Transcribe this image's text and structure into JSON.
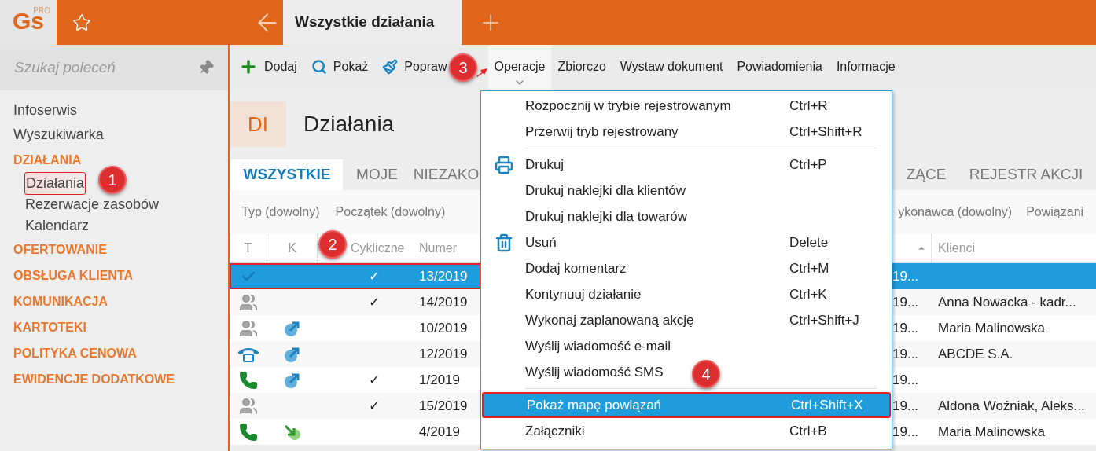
{
  "logo": {
    "text": "Gs",
    "badge": "PRO"
  },
  "top_tabs": [
    {
      "label": "Wszystkie działania",
      "selected": true
    }
  ],
  "sidebar": {
    "search": {
      "placeholder": "Szukaj poleceń"
    },
    "items": [
      {
        "kind": "link",
        "label": "Infoserwis"
      },
      {
        "kind": "link",
        "label": "Wyszukiwarka"
      },
      {
        "kind": "section",
        "label": "DZIAŁANIA",
        "children": [
          {
            "label": "Działania",
            "selected": true,
            "outlined": true
          },
          {
            "label": "Rezerwacje zasobów",
            "selected": false,
            "outlined": false
          },
          {
            "label": "Kalendarz",
            "selected": false,
            "outlined": false
          }
        ]
      },
      {
        "kind": "section",
        "label": "OFERTOWANIE"
      },
      {
        "kind": "section",
        "label": "OBSŁUGA KLIENTA"
      },
      {
        "kind": "section",
        "label": "KOMUNIKACJA"
      },
      {
        "kind": "section",
        "label": "KARTOTEKI"
      },
      {
        "kind": "section",
        "label": "POLITYKA CENOWA"
      },
      {
        "kind": "section",
        "label": "EWIDENCJE DODATKOWE"
      }
    ]
  },
  "toolbar": [
    {
      "kind": "add",
      "label": "Dodaj",
      "open": false
    },
    {
      "kind": "show",
      "label": "Pokaż",
      "open": false
    },
    {
      "kind": "edit",
      "label": "Popraw",
      "open": false
    },
    {
      "kind": "plain",
      "label": "Operacje",
      "open": true
    },
    {
      "kind": "plain",
      "label": "Zbiorczo",
      "open": false
    },
    {
      "kind": "plain",
      "label": "Wystaw dokument",
      "open": false
    },
    {
      "kind": "plain",
      "label": "Powiadomienia",
      "open": false
    },
    {
      "kind": "plain",
      "label": "Informacje",
      "open": false
    }
  ],
  "header": {
    "badge": "DI",
    "title": "Działania"
  },
  "view_tabs": [
    {
      "label": "WSZYSTKIE",
      "selected": true
    },
    {
      "label": "MOJE",
      "selected": false
    },
    {
      "label": "NIEZAKO",
      "selected": false
    },
    {
      "label": "ZĄCE",
      "selected": false
    },
    {
      "label": "REJESTR AKCJI",
      "selected": false
    }
  ],
  "filters": [
    "Typ (dowolny)",
    "Początek (dowolny)",
    "ykonawca (dowolny)",
    "Powiązani"
  ],
  "table": {
    "columns": [
      {
        "label": "T",
        "sorted": false
      },
      {
        "label": "K",
        "sorted": false
      },
      {
        "label": "Cykliczne",
        "sorted": false
      },
      {
        "label": "Numer",
        "sorted": false
      },
      {
        "sorted": true
      },
      {
        "label": "Klienci",
        "sorted": false
      }
    ],
    "rows": [
      {
        "t": {
          "kind": "check"
        },
        "cyclic": "✓",
        "number": "13/2019",
        "column_5": "19...",
        "selected": true,
        "outlined": true
      },
      {
        "t": {
          "kind": "people"
        },
        "cyclic": "✓",
        "number": "14/2019",
        "column_5": "19...",
        "clients": "Anna Nowacka - kadr...",
        "selected": false,
        "outlined": false
      },
      {
        "t": {
          "kind": "people"
        },
        "k": {
          "kind": "out"
        },
        "number": "10/2019",
        "column_5": "19...",
        "clients": "Maria Malinowska",
        "selected": false,
        "outlined": false
      },
      {
        "t": {
          "kind": "deskphone"
        },
        "k": {
          "kind": "out"
        },
        "number": "12/2019",
        "column_5": "19...",
        "clients": "ABCDE S.A.",
        "selected": false,
        "outlined": false
      },
      {
        "t": {
          "kind": "phone"
        },
        "k": {
          "kind": "out"
        },
        "cyclic": "✓",
        "number": "1/2019",
        "column_5": "19...",
        "selected": false,
        "outlined": false
      },
      {
        "t": {
          "kind": "people"
        },
        "cyclic": "✓",
        "number": "15/2019",
        "column_5": "19...",
        "clients": "Aldona Woźniak, Aleks...",
        "selected": false,
        "outlined": false
      },
      {
        "t": {
          "kind": "phone"
        },
        "k": {
          "kind": "in"
        },
        "number": "4/2019",
        "column_5": "19...",
        "clients": "Maria Malinowska",
        "selected": false,
        "outlined": false
      }
    ]
  },
  "menu": [
    {
      "kind": "plain",
      "label": "Rozpocznij w trybie rejestrowanym",
      "shortcut": "Ctrl+R",
      "selected": false,
      "outlined": false
    },
    {
      "kind": "plain",
      "label": "Przerwij tryb rejestrowany",
      "shortcut": "Ctrl+Shift+R",
      "selected": false,
      "outlined": false
    },
    {
      "kind": "separator"
    },
    {
      "kind": "printer",
      "label": "Drukuj",
      "shortcut": "Ctrl+P",
      "selected": false,
      "outlined": false
    },
    {
      "kind": "plain",
      "label": "Drukuj naklejki dla klientów",
      "selected": false,
      "outlined": false
    },
    {
      "kind": "plain",
      "label": "Drukuj naklejki dla towarów",
      "selected": false,
      "outlined": false
    },
    {
      "kind": "trash",
      "label": "Usuń",
      "shortcut": "Delete",
      "selected": false,
      "outlined": false
    },
    {
      "kind": "plain",
      "label": "Dodaj komentarz",
      "shortcut": "Ctrl+M",
      "selected": false,
      "outlined": false
    },
    {
      "kind": "plain",
      "label": "Kontynuuj działanie",
      "shortcut": "Ctrl+K",
      "selected": false,
      "outlined": false
    },
    {
      "kind": "plain",
      "label": "Wykonaj zaplanowaną akcję",
      "shortcut": "Ctrl+Shift+J",
      "selected": false,
      "outlined": false
    },
    {
      "kind": "plain",
      "label": "Wyślij wiadomość e-mail",
      "selected": false,
      "outlined": false
    },
    {
      "kind": "plain",
      "label": "Wyślij wiadomość SMS",
      "selected": false,
      "outlined": false
    },
    {
      "kind": "separator"
    },
    {
      "kind": "plain",
      "label": "Pokaż mapę powiązań",
      "shortcut": "Ctrl+Shift+X",
      "selected": true,
      "outlined": true
    },
    {
      "kind": "plain",
      "label": "Załączniki",
      "shortcut": "Ctrl+B",
      "selected": false,
      "outlined": false
    }
  ],
  "callouts": [
    {
      "label": "1"
    },
    {
      "label": "2"
    },
    {
      "label": "3"
    },
    {
      "label": "4"
    }
  ]
}
